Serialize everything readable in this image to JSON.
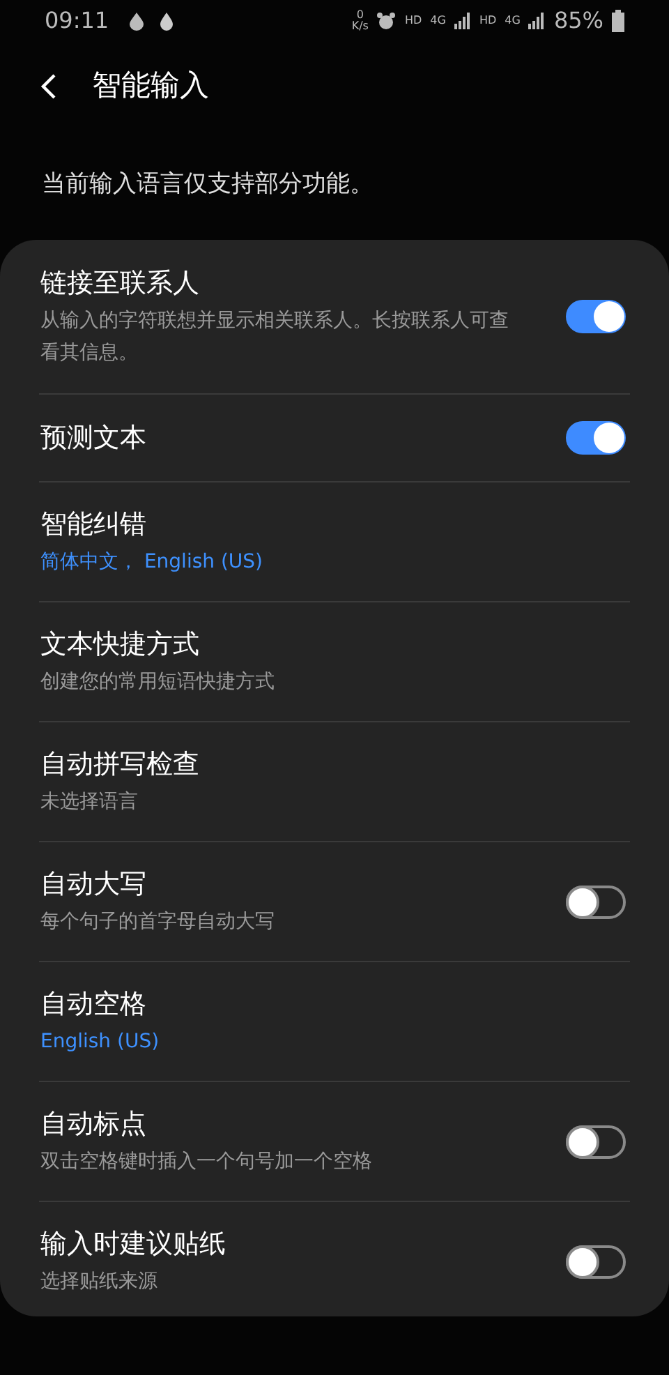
{
  "status_bar": {
    "time": "09:11",
    "net_speed_value": "0",
    "net_speed_unit": "K/s",
    "labels": [
      "HD",
      "4G",
      "HD",
      "4G"
    ],
    "battery": "85%"
  },
  "header": {
    "title": "智能输入"
  },
  "notice": "当前输入语言仅支持部分功能。",
  "settings": [
    {
      "title": "链接至联系人",
      "subtitle": "从输入的字符联想并显示相关联系人。长按联系人可查看其信息。",
      "subtitle_highlighted": false,
      "kind": "toggle",
      "on": true
    },
    {
      "title": "预测文本",
      "kind": "toggle",
      "on": true
    },
    {
      "title": "智能纠错",
      "subtitle": "简体中文， English (US)",
      "subtitle_highlighted": true,
      "kind": "link"
    },
    {
      "title": "文本快捷方式",
      "subtitle": "创建您的常用短语快捷方式",
      "subtitle_highlighted": false,
      "kind": "link"
    },
    {
      "title": "自动拼写检查",
      "subtitle": "未选择语言",
      "subtitle_highlighted": false,
      "kind": "link"
    },
    {
      "title": "自动大写",
      "subtitle": "每个句子的首字母自动大写",
      "subtitle_highlighted": false,
      "kind": "toggle",
      "on": false
    },
    {
      "title": "自动空格",
      "subtitle": "English (US)",
      "subtitle_highlighted": true,
      "kind": "link"
    },
    {
      "title": "自动标点",
      "subtitle": "双击空格键时插入一个句号加一个空格",
      "subtitle_highlighted": false,
      "kind": "toggle",
      "on": false
    },
    {
      "title": "输入时建议贴纸",
      "subtitle": "选择贴纸来源",
      "subtitle_highlighted": false,
      "kind": "toggle",
      "on": false
    }
  ]
}
